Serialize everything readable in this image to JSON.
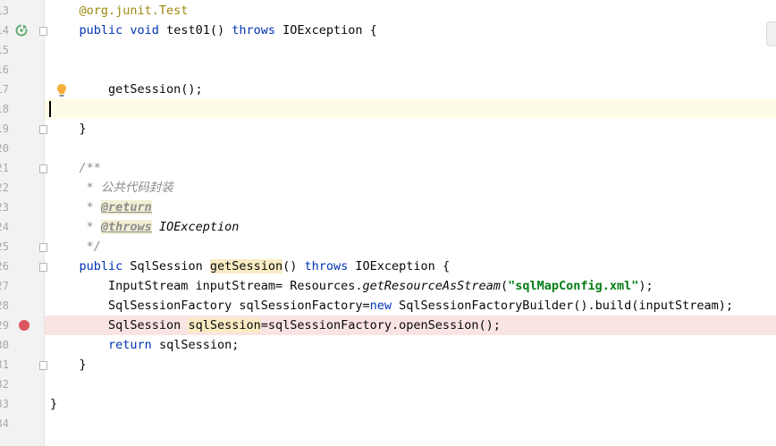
{
  "editor": {
    "lines": [
      {
        "no": "13",
        "tokens": [
          {
            "t": "    "
          },
          {
            "t": "@org.junit.",
            "c": "ann"
          },
          {
            "t": "Test",
            "c": "ann"
          }
        ]
      },
      {
        "no": "14",
        "tokens": [
          {
            "t": "    "
          },
          {
            "t": "public void ",
            "c": "kw"
          },
          {
            "t": "test01() "
          },
          {
            "t": "throws ",
            "c": "kw"
          },
          {
            "t": "IOException {"
          }
        ]
      },
      {
        "no": "15",
        "tokens": []
      },
      {
        "no": "16",
        "tokens": []
      },
      {
        "no": "17",
        "tokens": [
          {
            "t": "        getSession();"
          }
        ]
      },
      {
        "no": "18",
        "tokens": []
      },
      {
        "no": "19",
        "tokens": [
          {
            "t": "    }"
          }
        ]
      },
      {
        "no": "20",
        "tokens": []
      },
      {
        "no": "21",
        "tokens": [
          {
            "t": "    "
          },
          {
            "t": "/**",
            "c": "doc"
          }
        ]
      },
      {
        "no": "22",
        "tokens": [
          {
            "t": "     "
          },
          {
            "t": "* 公共代码封装",
            "c": "doc"
          }
        ]
      },
      {
        "no": "23",
        "tokens": [
          {
            "t": "     "
          },
          {
            "t": "* ",
            "c": "doc"
          },
          {
            "t": "@return",
            "c": "doctag"
          }
        ]
      },
      {
        "no": "24",
        "tokens": [
          {
            "t": "     "
          },
          {
            "t": "* ",
            "c": "doc"
          },
          {
            "t": "@throws",
            "c": "doctag"
          },
          {
            "t": " "
          },
          {
            "t": "IOException",
            "c": "doc-ex"
          }
        ]
      },
      {
        "no": "25",
        "tokens": [
          {
            "t": "     "
          },
          {
            "t": "*/",
            "c": "doc"
          }
        ]
      },
      {
        "no": "26",
        "tokens": [
          {
            "t": "    "
          },
          {
            "t": "public ",
            "c": "kw"
          },
          {
            "t": "SqlSession "
          },
          {
            "t": "getSession",
            "c": "mark"
          },
          {
            "t": "() "
          },
          {
            "t": "throws ",
            "c": "kw"
          },
          {
            "t": "IOException {"
          }
        ]
      },
      {
        "no": "27",
        "tokens": [
          {
            "t": "        InputStream inputStream= Resources."
          },
          {
            "t": "getResourceAsStream",
            "c": "method-it"
          },
          {
            "t": "("
          },
          {
            "t": "\"sqlMapConfig.xml\"",
            "c": "str"
          },
          {
            "t": ");"
          }
        ]
      },
      {
        "no": "28",
        "tokens": [
          {
            "t": "        SqlSessionFactory sqlSessionFactory="
          },
          {
            "t": "new ",
            "c": "kw"
          },
          {
            "t": "SqlSessionFactoryBuilder().build(inputStream);"
          }
        ]
      },
      {
        "no": "29",
        "tokens": [
          {
            "t": "        SqlSession "
          },
          {
            "t": "sqlSession",
            "c": "mark"
          },
          {
            "t": "=sqlSessionFactory.openSession();"
          }
        ]
      },
      {
        "no": "30",
        "tokens": [
          {
            "t": "        "
          },
          {
            "t": "return ",
            "c": "kw"
          },
          {
            "t": "sqlSession;"
          }
        ]
      },
      {
        "no": "31",
        "tokens": [
          {
            "t": "    }"
          }
        ]
      },
      {
        "no": "32",
        "tokens": []
      },
      {
        "no": "33",
        "tokens": [
          {
            "t": "}"
          }
        ]
      },
      {
        "no": "34",
        "tokens": []
      }
    ],
    "colors": {
      "keyword": "#0033b3",
      "annotation": "#9e880d",
      "string": "#067d17",
      "comment": "#8c8c8c",
      "caret_line": "#fefbe6",
      "breakpoint_line": "#fae3e3",
      "breakpoint": "#db5860"
    }
  }
}
